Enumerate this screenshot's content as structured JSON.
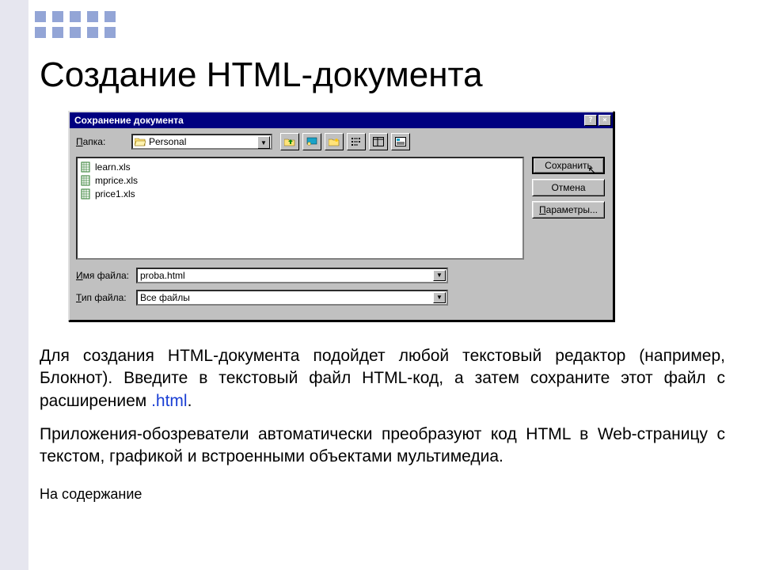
{
  "slide": {
    "title": "Создание HTML-документа",
    "para1_a": "Для создания HTML-документа подойдет любой текстовый редактор (например, Блокнот). Введите в текстовый файл HTML-код, а затем сохраните этот файл с расширением ",
    "para1_ext": ".html",
    "para1_b": ".",
    "para2": " Приложения-обозреватели автоматически преобразуют код HTML в Web-страницу с текстом, графикой и встроенными объектами мультимедиа.",
    "toc_link": "На содержание"
  },
  "dialog": {
    "title": "Сохранение документа",
    "folder_label": "Папка:",
    "folder_value": "Personal",
    "buttons": {
      "save": "Сохранить",
      "cancel": "Отмена",
      "options": "Параметры..."
    },
    "files": [
      "learn.xls",
      "mprice.xls",
      "price1.xls"
    ],
    "filename_label": "Имя файла:",
    "filename_value": "proba.html",
    "filetype_label": "Тип файла:",
    "filetype_value": "Все файлы",
    "titlebar_help": "?",
    "titlebar_close": "×",
    "tool_icons": {
      "up": "up-one-level-icon",
      "desktop": "desktop-icon",
      "newfolder": "new-folder-icon",
      "list": "list-view-icon",
      "details": "details-view-icon",
      "preview": "preview-icon"
    }
  }
}
